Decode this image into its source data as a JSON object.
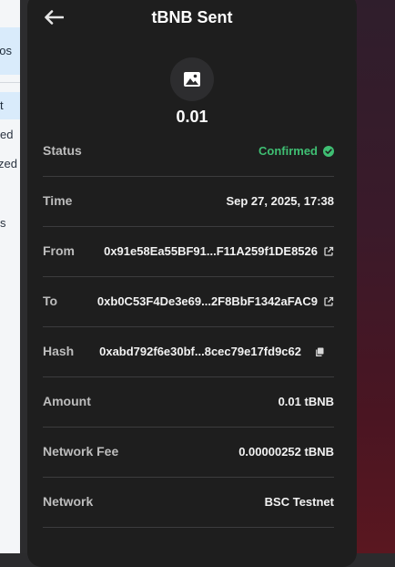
{
  "background": {
    "left_items": [
      "pos",
      "t",
      "ed",
      "zed",
      "s"
    ]
  },
  "header": {
    "title": "tBNB Sent"
  },
  "amount": "0.01",
  "details": {
    "status_label": "Status",
    "status_value": "Confirmed",
    "time_label": "Time",
    "time_value": "Sep 27, 2025, 17:38",
    "from_label": "From",
    "from_value": "0x91e58Ea55BF91...F11A259f1DE8526",
    "to_label": "To",
    "to_value": "0xb0C53F4De3e69...2F8BbF1342aFAC9",
    "hash_label": "Hash",
    "hash_value": "0xabd792f6e30bf...8cec79e17fd9c62",
    "amount_label": "Amount",
    "amount_value": "0.01 tBNB",
    "fee_label": "Network Fee",
    "fee_value": "0.00000252 tBNB",
    "network_label": "Network",
    "network_value": "BSC Testnet"
  },
  "colors": {
    "panel_bg": "#1e1e1e",
    "confirmed": "#3fbf73",
    "divider": "#3c3c3e"
  }
}
